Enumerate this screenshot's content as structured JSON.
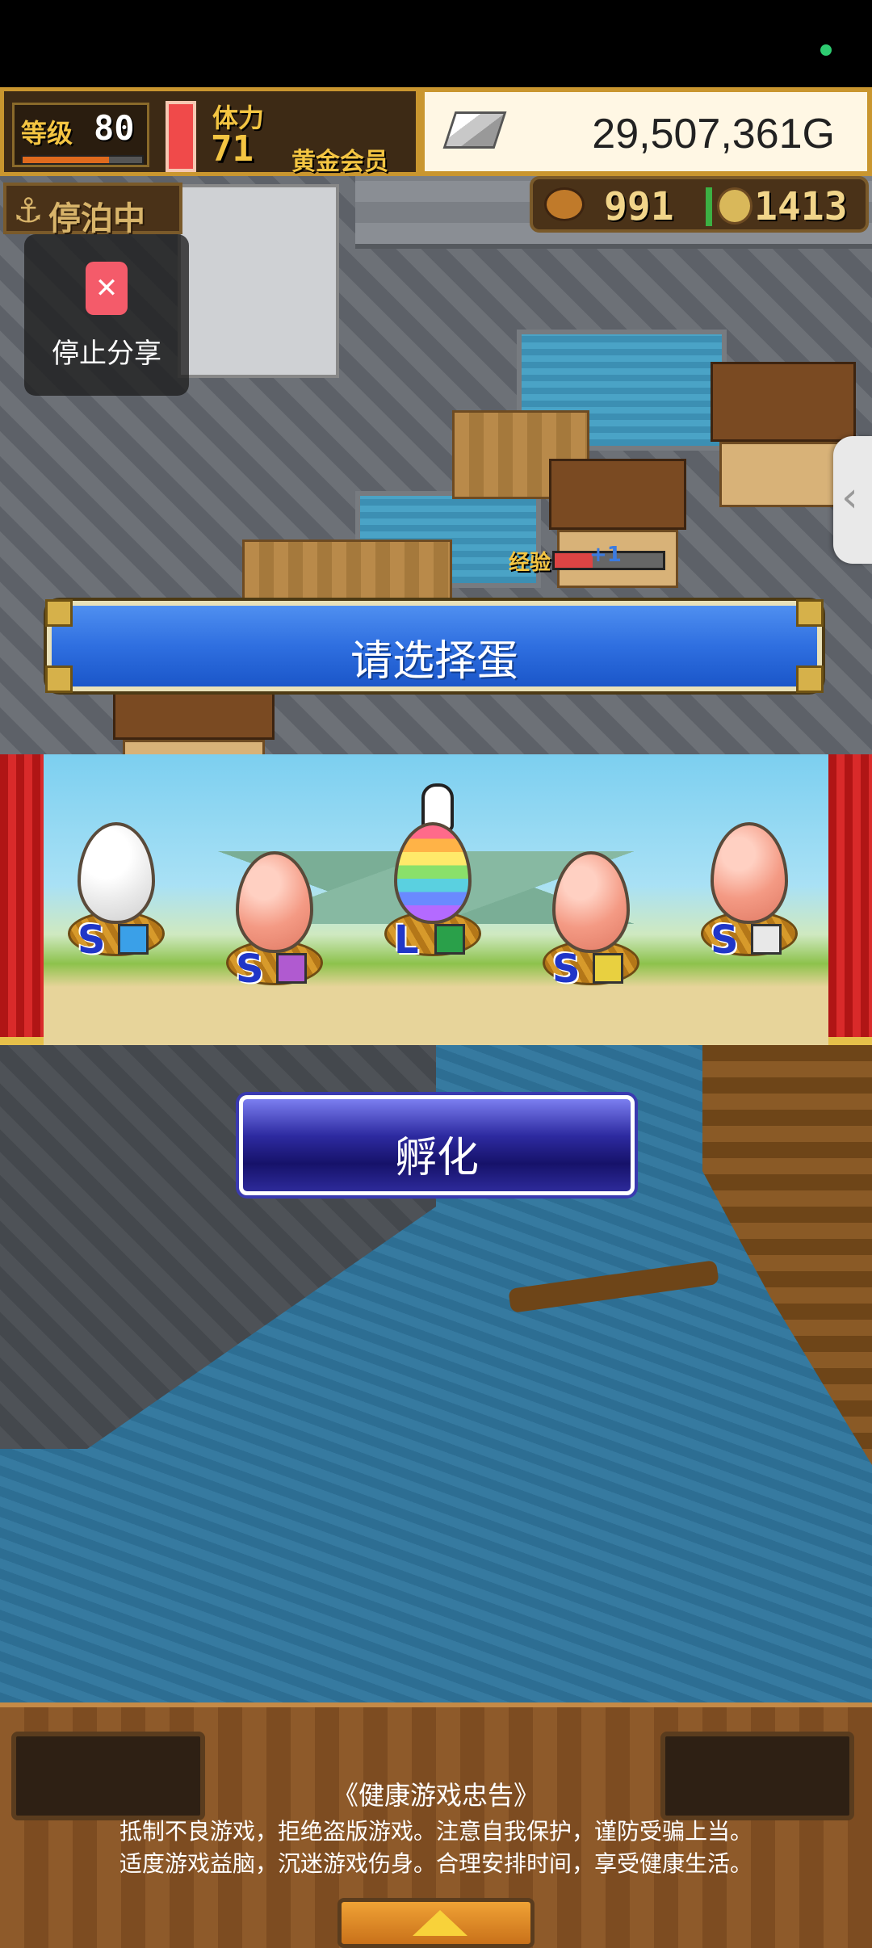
{
  "hud": {
    "level_label": "等级",
    "level_value": "80",
    "level_progress": 0.72,
    "stamina_label": "体力",
    "stamina_value": "71",
    "member_label": "黄金会员",
    "gold_value": "29,507,361G"
  },
  "status": {
    "dock_label": "停泊中",
    "food_value": "991",
    "coin_value": "1413"
  },
  "share": {
    "icon": "phone-stop-icon",
    "label": "停止分享"
  },
  "exp": {
    "label": "经验",
    "plus": "+1",
    "progress": 0.35
  },
  "dialog": {
    "title": "请选择蛋",
    "hatch_label": "孵化"
  },
  "eggs": [
    {
      "size": "S",
      "color": "white",
      "element_color": "#3aa0e8"
    },
    {
      "size": "S",
      "color": "pink",
      "element_color": "#b05ad0"
    },
    {
      "size": "L",
      "color": "rainbow",
      "element_color": "#2aa04a"
    },
    {
      "size": "S",
      "color": "pink",
      "element_color": "#e8d040"
    },
    {
      "size": "S",
      "color": "pink",
      "element_color": "#e8e8e8"
    }
  ],
  "notice": {
    "title": "《健康游戏忠告》",
    "line1": "抵制不良游戏，拒绝盗版游戏。注意自我保护，谨防受骗上当。",
    "line2": "适度游戏益脑，沉迷游戏伤身。合理安排时间，享受健康生活。"
  },
  "colors": {
    "banner_blue": "#2f6fe0",
    "hatch_indigo": "#16126a",
    "gold": "#c9962f"
  }
}
